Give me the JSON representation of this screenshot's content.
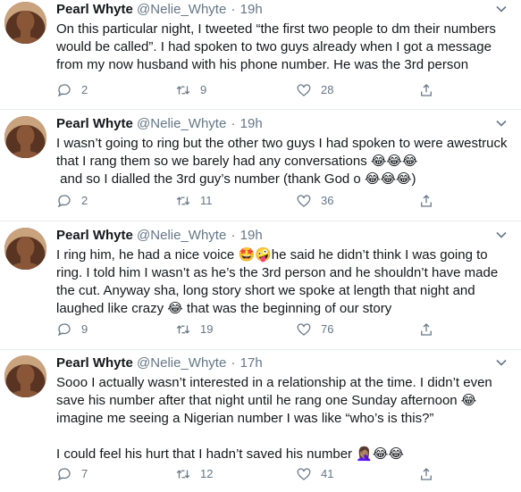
{
  "tweets": [
    {
      "name": "Pearl Whyte",
      "handle": "@Nelie_Whyte",
      "separator": "·",
      "time": "19h",
      "text": "On this particular night, I tweeted “the first two people to dm their numbers would be called”. I had spoken to two guys already when I got a message from my now husband with his phone number. He was the 3rd person",
      "replies": "2",
      "retweets": "9",
      "likes": "28"
    },
    {
      "name": "Pearl Whyte",
      "handle": "@Nelie_Whyte",
      "separator": "·",
      "time": "19h",
      "text": "I wasn’t going to ring but the other two guys I had spoken to were awestruck that I rang them so we barely had any conversations 😂😂😂\n and so I dialled the 3rd guy’s number (thank God o 😂😂😂)",
      "replies": "2",
      "retweets": "11",
      "likes": "36"
    },
    {
      "name": "Pearl Whyte",
      "handle": "@Nelie_Whyte",
      "separator": "·",
      "time": "19h",
      "text": "I ring him, he had a nice voice 🤩🤪he said he didn’t think I was going to ring. I told him I wasn’t as he’s the 3rd person and he shouldn’t have made the cut. Anyway sha, long story short we spoke at length that night and laughed like crazy 😂 that was the beginning of our story",
      "replies": "9",
      "retweets": "19",
      "likes": "76"
    },
    {
      "name": "Pearl Whyte",
      "handle": "@Nelie_Whyte",
      "separator": "·",
      "time": "17h",
      "text": "Sooo I actually wasn’t interested in a relationship at the time. I didn’t even save his number after that night until he rang one Sunday afternoon 😂\nimagine me seeing a Nigerian number I was like “who’s is this?”\n\nI could feel his hurt that I hadn’t saved his number 🤦🏽‍♀️😂😂",
      "replies": "7",
      "retweets": "12",
      "likes": "41"
    }
  ],
  "icons": {
    "reply": "reply-icon",
    "retweet": "retweet-icon",
    "like": "heart-icon",
    "share": "share-icon",
    "more": "chevron-down-icon"
  },
  "colors": {
    "name": "#14171a",
    "secondary": "#657786",
    "divider": "#e6ecf0"
  }
}
